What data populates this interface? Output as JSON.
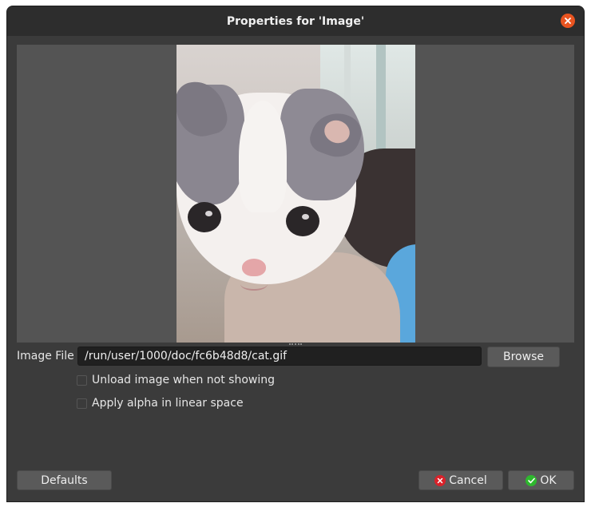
{
  "window": {
    "title": "Properties for 'Image'"
  },
  "icons": {
    "close": "close-icon",
    "cancel": "cancel-icon",
    "ok": "check-icon"
  },
  "colors": {
    "accent": "#e95420",
    "cancel_icon": "#d9222a",
    "ok_icon": "#2eb82e",
    "dialog_bg": "#3b3b3b",
    "preview_bg": "#545454"
  },
  "image_file": {
    "label": "Image File",
    "value": "/run/user/1000/doc/fc6b48d8/cat.gif",
    "browse_label": "Browse"
  },
  "options": [
    {
      "label": "Unload image when not showing",
      "checked": false
    },
    {
      "label": "Apply alpha in linear space",
      "checked": false
    }
  ],
  "footer": {
    "defaults_label": "Defaults",
    "cancel_label": "Cancel",
    "ok_label": "OK"
  }
}
